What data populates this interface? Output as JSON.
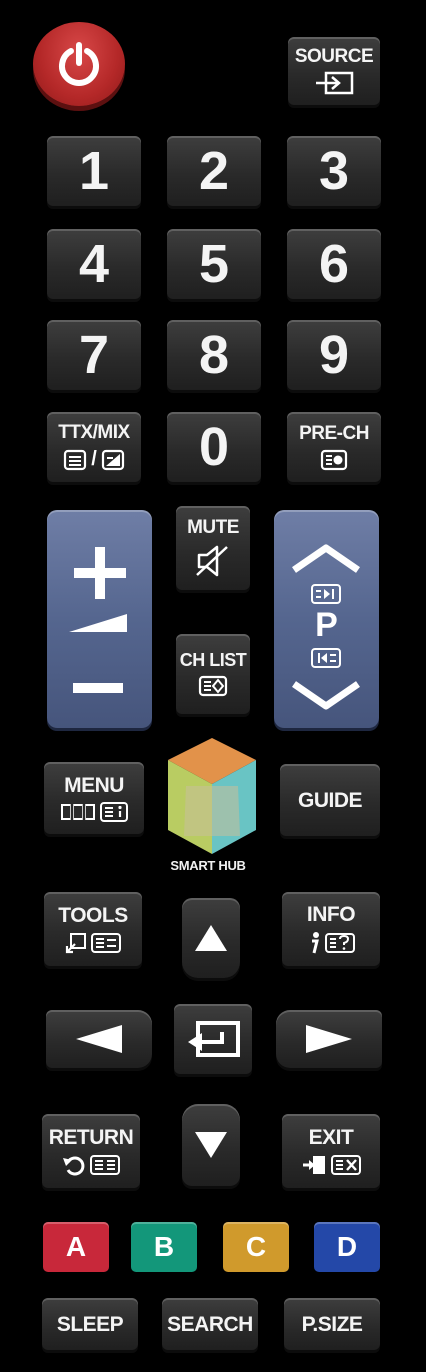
{
  "power": {
    "icon": "power-icon"
  },
  "source": {
    "label": "SOURCE",
    "icon": "source-input-icon"
  },
  "numbers": [
    "1",
    "2",
    "3",
    "4",
    "5",
    "6",
    "7",
    "8",
    "9",
    "0"
  ],
  "ttx": {
    "label": "TTX/MIX"
  },
  "prech": {
    "label": "PRE-CH"
  },
  "mute": {
    "label": "MUTE"
  },
  "chlist": {
    "label": "CH LIST"
  },
  "channel": {
    "label": "P"
  },
  "menu": {
    "label": "MENU"
  },
  "guide": {
    "label": "GUIDE"
  },
  "smarthub": {
    "label": "SMART HUB"
  },
  "tools": {
    "label": "TOOLS"
  },
  "info": {
    "label": "INFO"
  },
  "return_btn": {
    "label": "RETURN"
  },
  "exit": {
    "label": "EXIT"
  },
  "colors": [
    {
      "label": "A",
      "color": "#c8283a"
    },
    {
      "label": "B",
      "color": "#13977a"
    },
    {
      "label": "C",
      "color": "#d09a2c"
    },
    {
      "label": "D",
      "color": "#2448a8"
    }
  ],
  "bottom": {
    "sleep": "SLEEP",
    "search": "SEARCH",
    "psize": "P.SIZE"
  }
}
